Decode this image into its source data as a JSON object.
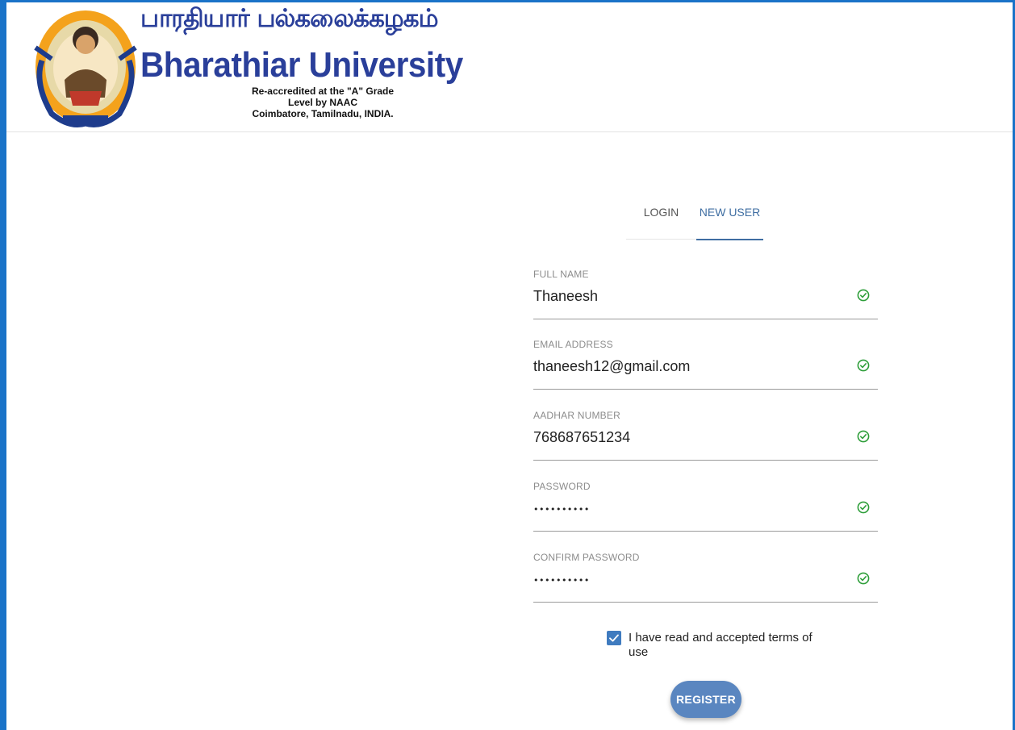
{
  "header": {
    "tamil_name": "பாரதியார் பல்கலைக்கழகம்",
    "english_name": "Bharathiar University",
    "accreditation": "Re-accredited at the \"A\" Grade Level by NAAC",
    "location": "Coimbatore, Tamilnadu, INDIA."
  },
  "tabs": {
    "login": "LOGIN",
    "new_user": "NEW USER",
    "active": "new_user"
  },
  "form": {
    "fields": [
      {
        "label": "FULL NAME",
        "value": "Thaneesh",
        "valid": true
      },
      {
        "label": "EMAIL ADDRESS",
        "value": "thaneesh12@gmail.com",
        "valid": true
      },
      {
        "label": "AADHAR NUMBER",
        "value": "768687651234",
        "valid": true
      },
      {
        "label": "PASSWORD",
        "masked": "••••••••••",
        "valid": true
      },
      {
        "label": "CONFIRM PASSWORD",
        "masked": "••••••••••",
        "valid": true
      }
    ],
    "terms_label": "I have read and accepted terms of use",
    "terms_checked": true,
    "register_label": "REGISTER"
  },
  "colors": {
    "accent": "#3f6ea2",
    "button": "#5a86c0",
    "checkbox": "#3f7bbf",
    "valid_icon": "#2e9e3a",
    "brand_text": "#2a3f9a",
    "frame": "#1a73c8"
  },
  "icons": {
    "valid": "check-circle-icon",
    "checkbox": "checkmark-icon"
  }
}
